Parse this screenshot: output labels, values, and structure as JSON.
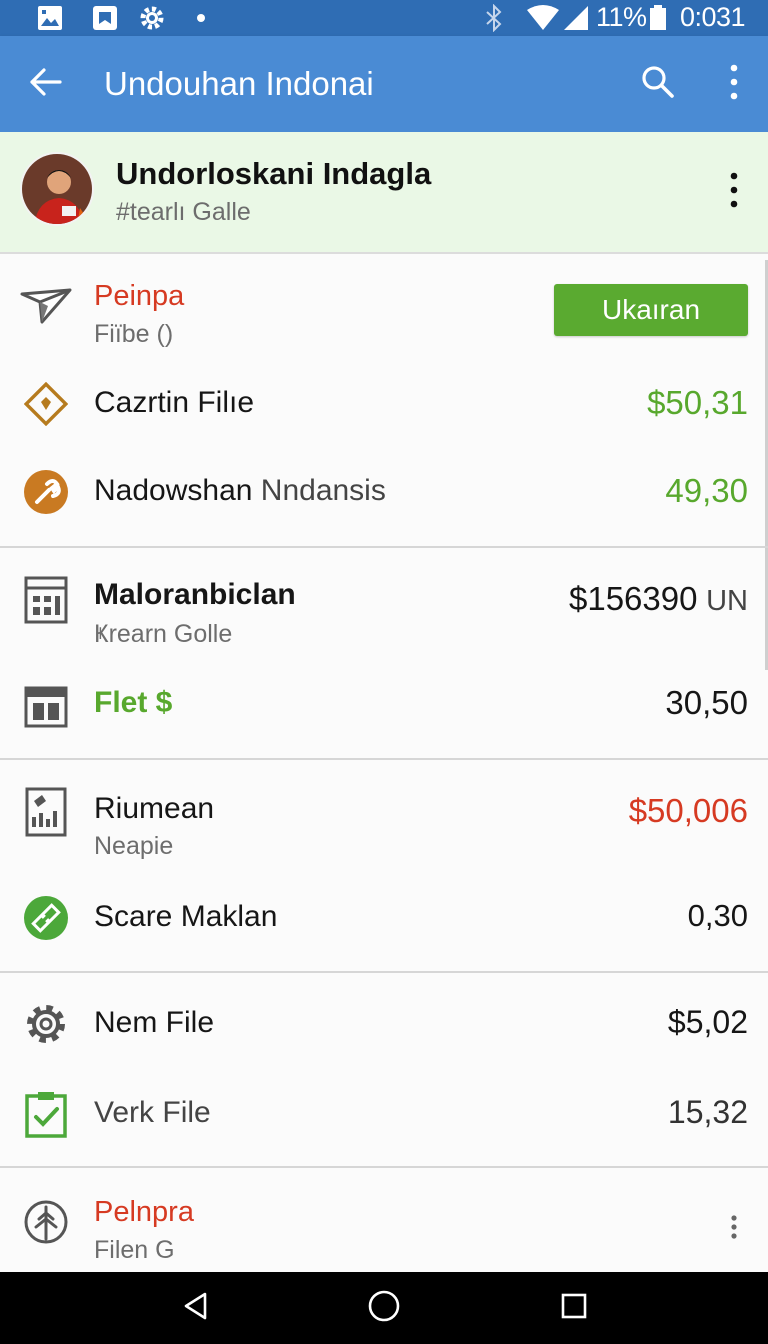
{
  "status_bar": {
    "battery": "11%",
    "time": "0:031",
    "icons": [
      "image-icon",
      "bookmark-icon",
      "gear-icon",
      "dot-icon",
      "bluetooth-icon",
      "wifi-icon",
      "signal-icon",
      "battery-icon"
    ]
  },
  "app_bar": {
    "title": "Undouhan Indonai",
    "icons": [
      "back-arrow-icon",
      "search-icon",
      "overflow-menu-icon"
    ]
  },
  "profile": {
    "name": "Undorloskani Indagla",
    "handle": "#tearlı Galle",
    "icons": [
      "avatar",
      "more-vert-icon"
    ]
  },
  "sections": [
    {
      "rows": [
        {
          "label": "Peinpa",
          "sub": "Fiïbe ()",
          "icon": "send-icon",
          "button": "Ukaıran"
        },
        {
          "label": "Cazrtin Filıe",
          "value": "$50,31",
          "icon": "tag-icon"
        },
        {
          "label": "Nadowshan",
          "label_extra": "Nndansis",
          "value": "49,30",
          "icon": "wrench-icon"
        }
      ]
    },
    {
      "rows": [
        {
          "label": "Maloranbiclan",
          "sub": "Ҝrearn Golle",
          "value": "$156390",
          "value_unit": "UN",
          "icon": "calculator-icon"
        },
        {
          "label": "Flet $",
          "value": "30,50",
          "icon": "calendar-icon"
        }
      ]
    },
    {
      "rows": [
        {
          "label": "Riumean",
          "sub": "Neapie",
          "value": "$50,006",
          "icon": "document-chart-icon"
        },
        {
          "label": "Scare Maklan",
          "value": "0,30",
          "icon": "ruler-icon"
        }
      ]
    },
    {
      "rows": [
        {
          "label": "Nem File",
          "value": "$5,02",
          "icon": "gear-icon"
        },
        {
          "label": "Verk File",
          "value": "15,32",
          "icon": "checklist-icon"
        }
      ]
    },
    {
      "rows": [
        {
          "label": "Pelnpra",
          "sub": "Filen G",
          "icon": "tree-icon"
        }
      ]
    }
  ],
  "colors": {
    "status_bar": "#2f6db4",
    "app_bar": "#4a8bd4",
    "profile_bg": "#eaf8e6",
    "accent_green": "#58a82d",
    "accent_red": "#d63a22",
    "button_green": "#5aaa30",
    "nav_bar": "#000000"
  },
  "nav_bar": {
    "icons": [
      "back-triangle-icon",
      "home-circle-icon",
      "recents-square-icon"
    ]
  }
}
